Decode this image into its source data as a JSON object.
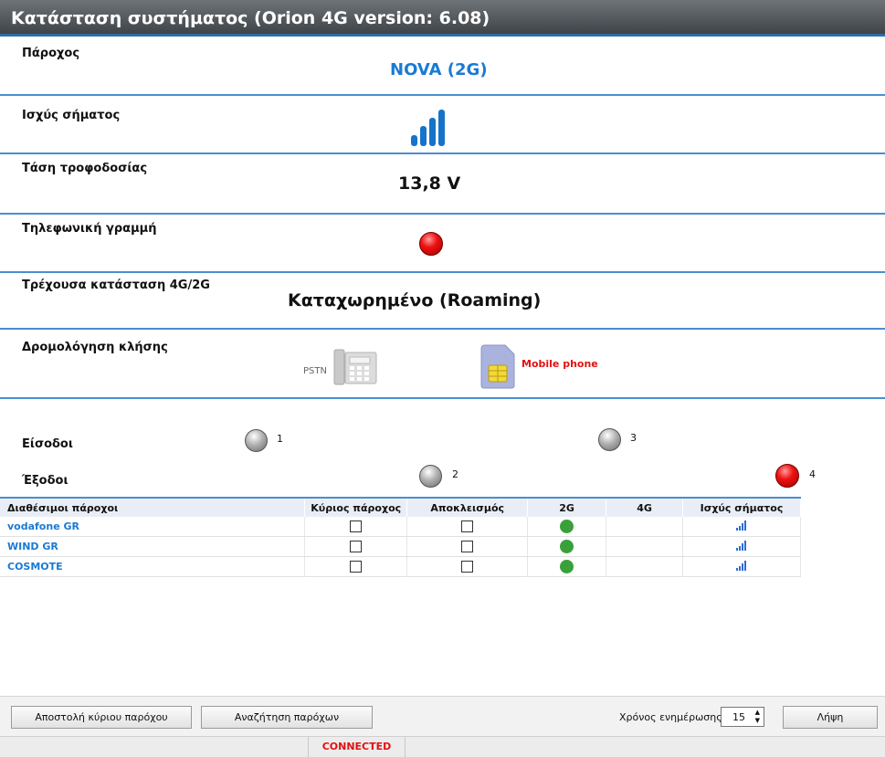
{
  "window": {
    "title": "Κατάσταση συστήματος (Orion 4G version: 6.08)"
  },
  "rows": {
    "provider": {
      "label": "Πάροχος",
      "value": "NOVA (2G)"
    },
    "signal": {
      "label": "Ισχύς σήματος",
      "level_bars": 4
    },
    "voltage": {
      "label": "Τάση τροφοδοσίας",
      "value": "13,8 V"
    },
    "phone_line": {
      "label": "Τηλεφωνική γραμμή",
      "state": "red"
    },
    "current_state": {
      "label": "Τρέχουσα κατάσταση 4G/2G",
      "value": "Καταχωρημένο (Roaming)"
    },
    "routing": {
      "label": "Δρομολόγηση κλήσης",
      "pstn_label": "PSTN",
      "mobile_label": "Mobile phone",
      "active": "Mobile phone"
    }
  },
  "io": {
    "inputs_label": "Είσοδοι",
    "outputs_label": "Έξοδοι",
    "leds": [
      {
        "number": "1",
        "state": "grey"
      },
      {
        "number": "2",
        "state": "grey"
      },
      {
        "number": "3",
        "state": "grey"
      },
      {
        "number": "4",
        "state": "red"
      }
    ]
  },
  "providers_table": {
    "headers": [
      "Διαθέσιμοι πάροχοι",
      "Κύριος πάροχος",
      "Αποκλεισμός",
      "2G",
      "4G",
      "Ισχύς σήματος"
    ],
    "rows": [
      {
        "name": "vodafone GR",
        "primary": false,
        "blocked": false,
        "has_2g": true,
        "has_4g": false,
        "signal": "low"
      },
      {
        "name": "WIND GR",
        "primary": false,
        "blocked": false,
        "has_2g": true,
        "has_4g": false,
        "signal": "low"
      },
      {
        "name": "COSMOTE",
        "primary": false,
        "blocked": false,
        "has_2g": true,
        "has_4g": false,
        "signal": "low"
      }
    ]
  },
  "footer": {
    "send_primary_label": "Αποστολή κύριου παρόχου",
    "search_providers_label": "Αναζήτηση παρόχων",
    "refresh_time_label": "Χρόνος ενημέρωσης",
    "refresh_time_value": "15",
    "fetch_label": "Λήψη"
  },
  "statusbar": {
    "connection": "CONNECTED"
  },
  "colors": {
    "accent": "#4a8ed0",
    "link": "#1a7ad4",
    "alert": "#e21111",
    "ok": "#3aa03a"
  }
}
